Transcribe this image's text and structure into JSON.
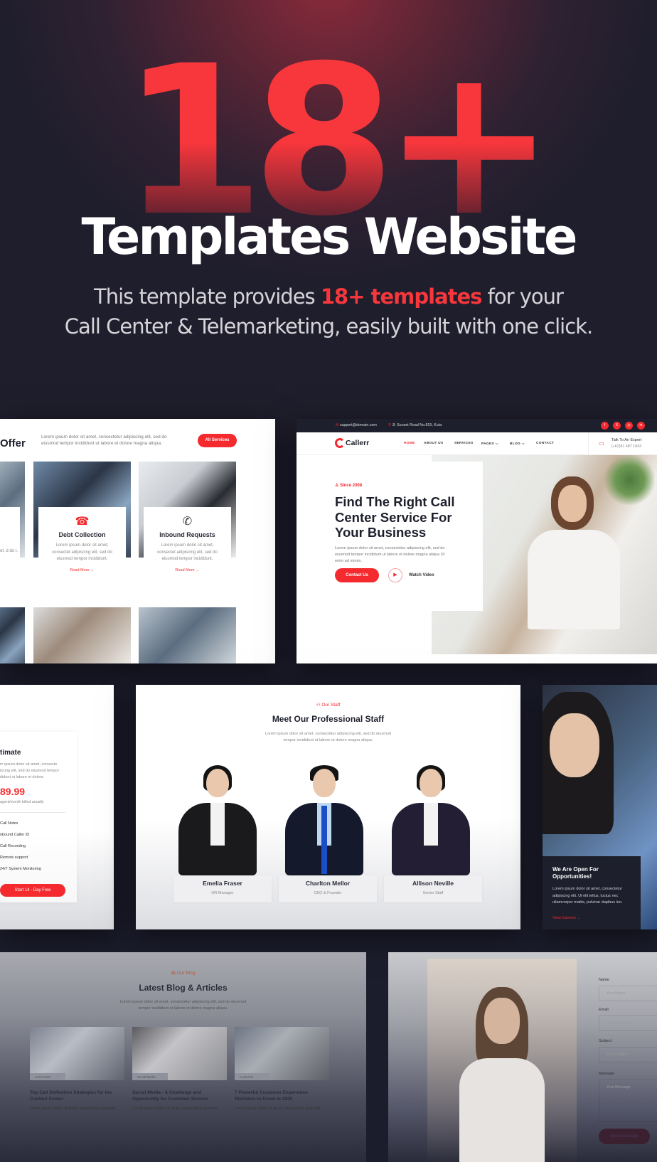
{
  "hero": {
    "big_number": "18+",
    "title": "Templates Website",
    "subtitle_before": "This template provides ",
    "subtitle_highlight": "18+ templates",
    "subtitle_after": " for your",
    "subtitle_line2": "Call Center & Telemarketing, easily built with one click.",
    "accent_color": "#f8373c"
  },
  "services_panel": {
    "title": "Offer",
    "description": "Lorem ipsum dolor sit amet, consectetur adipiscing elit, sed do eiusmod tempor incididunt ut labore et dolore magna aliqua.",
    "all_button": "All Services",
    "partial_card_text": "et, d do t.",
    "cards": [
      {
        "icon": "phone-icon",
        "title": "Debt Collection",
        "description": "Lorem ipsum dolor sit amet, consectet adipiscing elit, sed do eiusmod tempor incididunt.",
        "link": "Read More →"
      },
      {
        "icon": "inbound-call-icon",
        "title": "Inbound Requests",
        "description": "Lorem ipsum dolor sit amet, consectet adipiscing elit, sed do eiusmod tempor incididunt.",
        "link": "Read More →"
      }
    ]
  },
  "website_panel": {
    "topbar": {
      "email": "support@domain.com",
      "address": "Jl. Sunset Road No.815, Kuta",
      "socials": [
        "f",
        "X",
        "◎",
        "in"
      ]
    },
    "logo": "Callerr",
    "nav": [
      {
        "label": "HOME",
        "active": true
      },
      {
        "label": "ABOUT US",
        "active": false
      },
      {
        "label": "SERVICES",
        "active": false
      },
      {
        "label": "PAGES ⌵",
        "active": false
      },
      {
        "label": "BLOG ⌵",
        "active": false
      },
      {
        "label": "CONTACT",
        "active": false
      }
    ],
    "expert": {
      "label": "Talk To An Expert",
      "phone": "(+62)81 487 1843"
    },
    "since": "Since 2008",
    "headline": "Find The Right Call Center Service For Your Business",
    "description": "Lorem ipsum dolor sit amet, consectetur adipiscing elit, sed do eiusmod tempor incididunt ut labore et dolore magna aliqua Ut enim ad minim.",
    "contact_button": "Contact Us",
    "watch_label": "Watch Video"
  },
  "pricing_panel": {
    "plan": "timate",
    "description": "m ipsum dolor sit amet, consecte iscing elit, sed do eiusmod tempor didunt ut labore et dolore.",
    "price": "89.99",
    "period": "agent/month billed anually",
    "features": [
      "Call Notes",
      "nbound Caller ID",
      "Call Recording",
      "Remote support",
      "24/7 System Monitoring"
    ],
    "button": "Start 14 - Day Free"
  },
  "staff_panel": {
    "tag": "Our Staff",
    "title": "Meet Our Professional Staff",
    "description_1": "Lorem ipsum dolor sit amet, consectetur adipiscing elit, sed do eiusmod",
    "description_2": "tempor incididunt ut labore et dolore magna aliqua.",
    "members": [
      {
        "name": "Emelia Fraser",
        "role": "HR Manager"
      },
      {
        "name": "Charlton Mellor",
        "role": "CEO & Founder"
      },
      {
        "name": "Allison Neville",
        "role": "Senior Staff"
      }
    ]
  },
  "career_panel": {
    "title": "We Are Open For Opportunities!",
    "description": "Lorem ipsum dolor sit amet, consectetur adipiscing elit. Ut elit tellus, luctus nec ullamcorper mattis, pulvinar dapibus leo.",
    "link": "View Careers →"
  },
  "blog_panel": {
    "tag": "Our Blog",
    "title": "Latest Blog & Articles",
    "description_1": "Lorem ipsum dolor sit amet, consectetur adipiscing elit, sed do eiusmod",
    "description_2": "tempor incididunt ut labore et dolore magna aliqua.",
    "posts": [
      {
        "category": "Call Center",
        "title": "Top Call Deflection Strategies for the Contact Center",
        "excerpt": "Lorem ipsum dolor sit amet, consectetur eiusmod"
      },
      {
        "category": "Social Media",
        "title": "Social Media - A Challenge and Opportunity for Customer Service",
        "excerpt": "Lorem ipsum dolor sit amet, consectetur eiusmod"
      },
      {
        "category": "Customer",
        "title": "7 Powerful Customer Experience Statistics to Know in 2025",
        "excerpt": "Lorem ipsum dolor sit amet, consectetur eiusmod"
      }
    ]
  },
  "contact_panel": {
    "fields": [
      {
        "label": "Name",
        "placeholder": "Your Name"
      },
      {
        "label": "Email",
        "placeholder": "Email Address"
      },
      {
        "label": "Subject",
        "placeholder": "Your Subject"
      },
      {
        "label": "Message",
        "placeholder": "Your Message"
      }
    ],
    "send_button": "Send Message"
  }
}
